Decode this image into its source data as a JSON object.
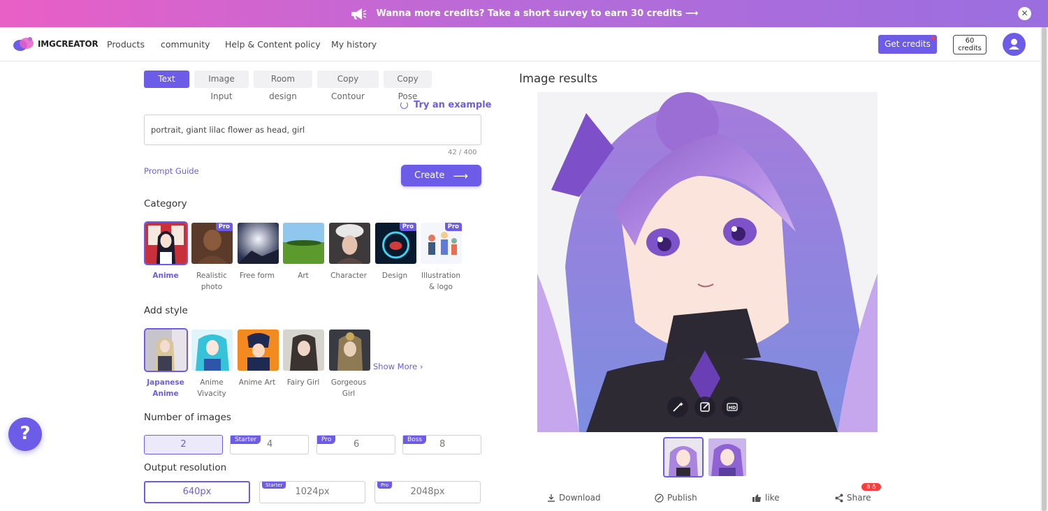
{
  "banner": {
    "text": "Wanna more credits? Take a short survey to earn 30 credits ⟶",
    "icon": "megaphone-icon",
    "close_icon": "close-icon"
  },
  "nav": {
    "logo_text": "IMGCREATOR",
    "links": [
      "Products",
      "community",
      "Help & Content policy",
      "My history"
    ],
    "get_credits": "Get credits",
    "credits_value": "60",
    "credits_unit": "credits",
    "avatar_icon": "user-icon"
  },
  "tabs": [
    {
      "label": "Text Input",
      "active": true
    },
    {
      "label": "Image Input"
    },
    {
      "label": "Room design"
    },
    {
      "label": "Copy Contour"
    },
    {
      "label": "Copy Pose"
    }
  ],
  "prompt": {
    "try_example": "Try an example",
    "value": "portrait, giant lilac flower as head, girl",
    "counter": "42 / 400",
    "guide": "Prompt Guide",
    "create": "Create",
    "create_icon": "arrow-right-icon"
  },
  "category": {
    "title": "Category",
    "pro": "Pro",
    "items": [
      {
        "label": "Anime",
        "selected": true
      },
      {
        "label": "Realistic photo",
        "line1": "Realistic",
        "line2": "photo",
        "pro": true
      },
      {
        "label": "Free form"
      },
      {
        "label": "Art"
      },
      {
        "label": "Character"
      },
      {
        "label": "Design",
        "pro": true
      },
      {
        "label": "Illustration & logo",
        "line1": "Illustration",
        "line2": "& logo",
        "pro": true
      }
    ]
  },
  "style": {
    "title": "Add style",
    "show_more": "Show More ›",
    "items": [
      {
        "line1": "Japanese",
        "line2": "Anime",
        "selected": true
      },
      {
        "line1": "Anime",
        "line2": "Vivacity"
      },
      {
        "line1": "Anime Art",
        "line2": ""
      },
      {
        "line1": "Fairy Girl",
        "line2": ""
      },
      {
        "line1": "Gorgeous",
        "line2": "Girl"
      }
    ]
  },
  "number": {
    "title": "Number of images",
    "options": [
      {
        "value": "2",
        "tier": "",
        "selected": true
      },
      {
        "value": "4",
        "tier": "Starter"
      },
      {
        "value": "6",
        "tier": "Pro"
      },
      {
        "value": "8",
        "tier": "Boss"
      }
    ]
  },
  "resolution": {
    "title": "Output resolution",
    "options": [
      {
        "value": "640px",
        "tier": "",
        "selected": true
      },
      {
        "value": "1024px",
        "tier": "Starter"
      },
      {
        "value": "2048px",
        "tier": "Pro"
      }
    ]
  },
  "help": {
    "label": "?"
  },
  "results": {
    "title": "Image results",
    "tools": [
      "magic-wand-icon",
      "edit-icon",
      "hd-icon"
    ],
    "hd": "HD",
    "actions": {
      "download": "Download",
      "publish": "Publish",
      "like": "like",
      "share": "Share",
      "share_badge": "8 ♁"
    }
  },
  "colors": {
    "accent": "#6c5ce7",
    "banner_start": "#e95fc6",
    "banner_end": "#9a6ee0",
    "alert": "#ff3b3b"
  }
}
